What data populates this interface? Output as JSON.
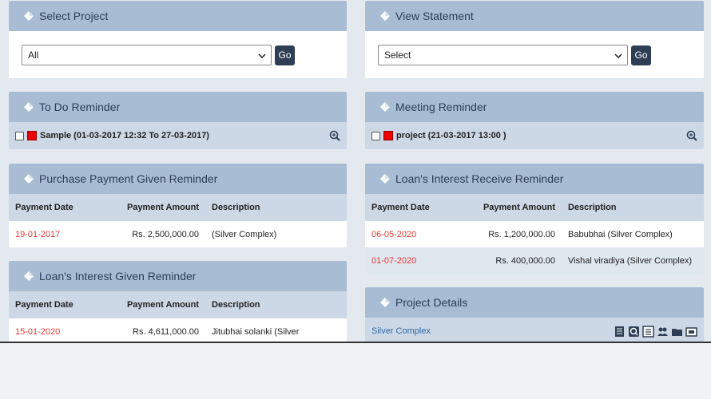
{
  "select_project": {
    "title": "Select Project",
    "value": "All",
    "go": "Go"
  },
  "view_statement": {
    "title": "View Statement",
    "value": "Select",
    "go": "Go"
  },
  "todo": {
    "title": "To Do Reminder",
    "item": "Sample (01-03-2017 12:32 To 27-03-2017)"
  },
  "meeting": {
    "title": "Meeting Reminder",
    "item": "project (21-03-2017 13:00 )"
  },
  "purchase": {
    "title": "Purchase Payment Given Reminder",
    "headers": [
      "Payment Date",
      "Payment Amount",
      "Description"
    ],
    "rows": [
      {
        "date": "19-01-2017",
        "amount": "Rs. 2,500,000.00",
        "desc": "(Silver Complex)"
      }
    ]
  },
  "loan_receive": {
    "title": "Loan's Interest Receive Reminder",
    "headers": [
      "Payment Date",
      "Payment Amount",
      "Description"
    ],
    "rows": [
      {
        "date": "06-05-2020",
        "amount": "Rs. 1,200,000.00",
        "desc": "Babubhai (Silver Complex)"
      },
      {
        "date": "01-07-2020",
        "amount": "Rs. 400,000.00",
        "desc": "Vishal viradiya (Silver Complex)"
      }
    ]
  },
  "loan_given": {
    "title": "Loan's Interest Given Reminder",
    "headers": [
      "Payment Date",
      "Payment Amount",
      "Description"
    ],
    "rows": [
      {
        "date": "15-01-2020",
        "amount": "Rs. 4,611,000.00",
        "desc": "Jitubhai solanki (Silver"
      }
    ]
  },
  "project_details": {
    "title": "Project Details",
    "project": "Silver Complex",
    "icons": [
      "report-icon",
      "search-report-icon",
      "list-icon",
      "users-icon",
      "folder-icon",
      "card-icon"
    ]
  },
  "colors": {
    "header": "#a8bdd4",
    "row": "#ccd8e6",
    "date": "#e53935",
    "button": "#2e3f55"
  }
}
